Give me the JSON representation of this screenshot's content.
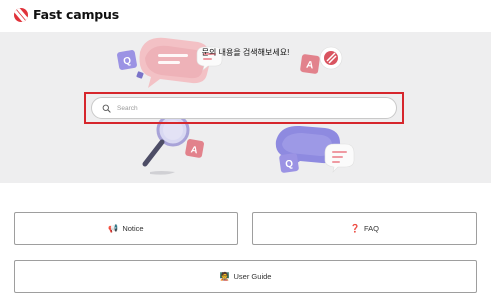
{
  "header": {
    "brand": "Fast campus"
  },
  "hero": {
    "headline": "문의 내용을 검색해보세요!",
    "search": {
      "placeholder": "Search",
      "value": ""
    }
  },
  "quick_links": [
    {
      "icon": "📢",
      "label": "Notice"
    },
    {
      "icon": "❓",
      "label": "FAQ"
    },
    {
      "icon": "🧑‍🏫",
      "label": "User Guide"
    }
  ],
  "deco_letters": {
    "q": "Q",
    "a": "A"
  },
  "colors": {
    "brand": "#e0323a",
    "highlight": "#d6262c",
    "hero_bg": "#eeeeef"
  }
}
